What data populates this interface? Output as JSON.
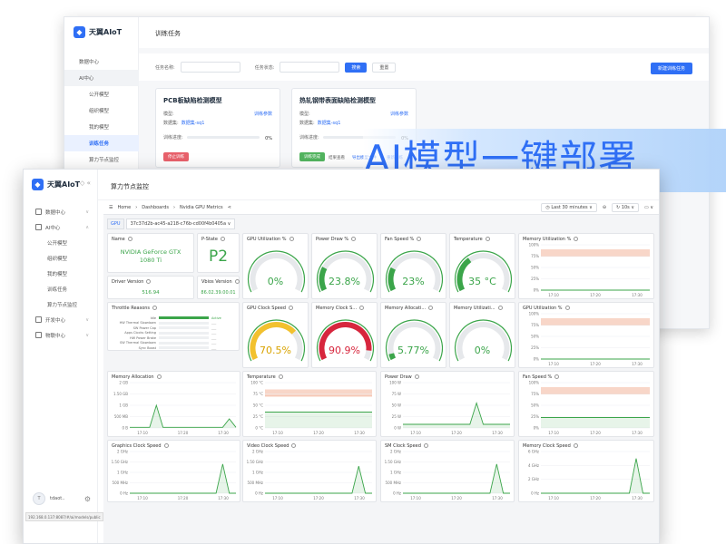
{
  "colors": {
    "accent": "#2f6ff5",
    "green": "#3ba54a",
    "yellow": "#f2c12e",
    "red": "#d7263d",
    "orange_band": "#f2b8a2"
  },
  "back_window": {
    "brand": "天翼AIoT",
    "menu": [
      {
        "label": "数据中心",
        "type": "item"
      },
      {
        "label": "AI中心",
        "type": "group"
      },
      {
        "label": "公开模型",
        "type": "sub"
      },
      {
        "label": "组织模型",
        "type": "sub"
      },
      {
        "label": "我的模型",
        "type": "sub"
      },
      {
        "label": "训练任务",
        "type": "active"
      },
      {
        "label": "算力节点监控",
        "type": "sub"
      },
      {
        "label": "开发中心",
        "type": "item"
      }
    ],
    "page_title": "训练任务",
    "filter": {
      "task_name_label": "任务名称:",
      "task_status_label": "任务状态:",
      "search": "搜索",
      "reset": "重置",
      "new_task": "新建训练任务"
    },
    "cards": [
      {
        "title": "PCB板缺陷检测模型",
        "model_label": "模型:",
        "model_link": "训练参数",
        "dataset_label": "数据集:",
        "dataset_value": "数据集-sq1",
        "progress_label": "训练进度:",
        "progress": "0%",
        "tag": "停止训练",
        "tag_color": "#e8616b"
      },
      {
        "title": "热轧钢带表面缺陷检测模型",
        "model_label": "模型:",
        "model_link": "训练参数",
        "dataset_label": "数据集:",
        "dataset_value": "数据集-sq1",
        "progress_label": "训练进度:",
        "progress": "0%",
        "tag": "训练完成",
        "tag_color": "#52b45f",
        "extra1": "结果查看",
        "extra2": "导出模型文件",
        "extra3": "重新训练"
      }
    ]
  },
  "banner": {
    "text": "AI模型一键部署"
  },
  "front_window": {
    "brand": "天翼AIoT",
    "menu": [
      {
        "label": "数据中心",
        "type": "item",
        "chev": "∨"
      },
      {
        "label": "AI中心",
        "type": "item",
        "chev": "∧"
      },
      {
        "label": "公开模型",
        "type": "sub"
      },
      {
        "label": "组织模型",
        "type": "sub"
      },
      {
        "label": "我的模型",
        "type": "sub"
      },
      {
        "label": "训练任务",
        "type": "sub"
      },
      {
        "label": "算力节点监控",
        "type": "sub"
      },
      {
        "label": "开发中心",
        "type": "item",
        "chev": "∨"
      },
      {
        "label": "物联中心",
        "type": "item",
        "chev": "∨"
      }
    ],
    "page_title": "算力节点监控",
    "user": {
      "avatar": "T",
      "name": "tdaot.."
    },
    "status_url": "192.168.0.137:8087/#/ai/models/public"
  },
  "grafana": {
    "breadcrumb": [
      "Home",
      "Dashboards",
      "Nvidia GPU Metrics"
    ],
    "time_range": "Last 30 minutes",
    "refresh": "10s",
    "var_label": "GPU",
    "var_value": "37c37d2b-ac45-a218-c76b-cd00f4b0405a"
  },
  "panels": {
    "name": {
      "title": "Name",
      "value": "NVIDIA GeForce GTX 1080 Ti"
    },
    "pstate": {
      "title": "P-State",
      "value": "P2"
    },
    "driver": {
      "title": "Driver Version",
      "value": "516.94"
    },
    "vbios": {
      "title": "Vbios Version",
      "value": "86.02.39.00.01"
    },
    "throttle": {
      "title": "Throttle Reasons",
      "rows": [
        "Idle",
        "HW Thermal Slowdown",
        "SW Power Cap",
        "Apps Clocks Setting",
        "HW Power Brake",
        "SW Thermal Slowdown",
        "Sync Boost"
      ],
      "active_label": "Active"
    },
    "gauges": [
      {
        "title": "GPU Utilization %",
        "value": 0,
        "display": "0%",
        "color": "#3ba54a"
      },
      {
        "title": "Power Draw %",
        "value": 23.8,
        "display": "23.8%",
        "color": "#3ba54a"
      },
      {
        "title": "Fan Speed %",
        "value": 23,
        "display": "23%",
        "color": "#3ba54a"
      },
      {
        "title": "Temperature",
        "value": 35,
        "display": "35 °C",
        "color": "#3ba54a"
      },
      {
        "title": "GPU Clock Speed",
        "value": 70.5,
        "display": "70.5%",
        "color": "#f2c12e"
      },
      {
        "title": "Memory Clock S...",
        "value": 90.9,
        "display": "90.9%",
        "color": "#d7263d"
      },
      {
        "title": "Memory Allocati...",
        "value": 5.77,
        "display": "5.77%",
        "color": "#3ba54a"
      },
      {
        "title": "Memory Utilizati...",
        "value": 0,
        "display": "0%",
        "color": "#3ba54a"
      }
    ]
  },
  "chart_data": [
    {
      "type": "line",
      "title": "Memory Utilization %",
      "y_ticks": [
        "100%",
        "75%",
        "50%",
        "25%",
        "0%"
      ],
      "x_ticks": [
        "17:10",
        "17:20",
        "17:30"
      ],
      "ylim": [
        0,
        100
      ],
      "threshold_bands": [
        [
          75,
          90
        ]
      ],
      "values": [
        0,
        0,
        0,
        0,
        0,
        0,
        0,
        0
      ]
    },
    {
      "type": "line",
      "title": "GPU Utilization %",
      "y_ticks": [
        "100%",
        "75%",
        "50%",
        "25%",
        "0%"
      ],
      "x_ticks": [
        "17:10",
        "17:20",
        "17:30"
      ],
      "ylim": [
        0,
        100
      ],
      "threshold_bands": [
        [
          75,
          90
        ]
      ],
      "values": [
        0,
        0,
        0,
        0,
        0,
        0,
        0,
        0
      ]
    },
    {
      "type": "line",
      "title": "Memory Allocation",
      "y_ticks": [
        "2 GB",
        "1.50 GB",
        "1 GB",
        "500 MB",
        "0 B"
      ],
      "x_ticks": [
        "17:10",
        "17:20",
        "17:30"
      ],
      "ylim": [
        0,
        2
      ],
      "values": [
        0.03,
        0.03,
        0.03,
        0.03,
        1.0,
        0.03,
        0.03,
        0.03,
        0.03,
        0.03,
        0.03,
        0.03,
        0.03,
        0.03,
        0.03,
        0.4,
        0.03
      ]
    },
    {
      "type": "line",
      "title": "Temperature",
      "y_ticks": [
        "100 °C",
        "75 °C",
        "50 °C",
        "25 °C",
        "0 °C"
      ],
      "x_ticks": [
        "17:10",
        "17:20",
        "17:30"
      ],
      "ylim": [
        0,
        100
      ],
      "threshold_bands": [
        [
          70,
          85
        ]
      ],
      "values": [
        35,
        35,
        35,
        35,
        35,
        35,
        35,
        35,
        35,
        35,
        35,
        35,
        35,
        35,
        35,
        35,
        35
      ]
    },
    {
      "type": "line",
      "title": "Power Draw",
      "y_ticks": [
        "100 W",
        "75 W",
        "50 W",
        "25 W",
        "0 W"
      ],
      "x_ticks": [
        "17:10",
        "17:20",
        "17:30"
      ],
      "ylim": [
        0,
        100
      ],
      "values": [
        8,
        8,
        8,
        8,
        8,
        8,
        8,
        8,
        8,
        8,
        8,
        55,
        8,
        8,
        8,
        8,
        8
      ]
    },
    {
      "type": "line",
      "title": "Fan Speed %",
      "y_ticks": [
        "100%",
        "75%",
        "50%",
        "25%",
        "0%"
      ],
      "x_ticks": [
        "17:10",
        "17:20",
        "17:30"
      ],
      "ylim": [
        0,
        100
      ],
      "threshold_bands": [
        [
          75,
          90
        ]
      ],
      "values": [
        23,
        23,
        23,
        23,
        23,
        23,
        23,
        23,
        23,
        23,
        23,
        23,
        23,
        23,
        23,
        23,
        23
      ]
    },
    {
      "type": "line",
      "title": "Graphics Clock Speed",
      "y_ticks": [
        "2 GHz",
        "1.50 GHz",
        "1 GHz",
        "500 MHz",
        "0 Hz"
      ],
      "x_ticks": [
        "17:10",
        "17:20",
        "17:30"
      ],
      "ylim": [
        0,
        2000
      ],
      "values": [
        0,
        0,
        0,
        0,
        0,
        0,
        0,
        0,
        0,
        0,
        0,
        0,
        0,
        0,
        1400,
        0,
        0
      ]
    },
    {
      "type": "line",
      "title": "Video Clock Speed",
      "y_ticks": [
        "2 GHz",
        "1.50 GHz",
        "1 GHz",
        "500 MHz",
        "0 Hz"
      ],
      "x_ticks": [
        "17:10",
        "17:20",
        "17:30"
      ],
      "ylim": [
        0,
        2000
      ],
      "values": [
        0,
        0,
        0,
        0,
        0,
        0,
        0,
        0,
        0,
        0,
        0,
        0,
        0,
        0,
        1300,
        0,
        0
      ]
    },
    {
      "type": "line",
      "title": "SM Clock Speed",
      "y_ticks": [
        "2 GHz",
        "1.50 GHz",
        "1 GHz",
        "500 MHz",
        "0 Hz"
      ],
      "x_ticks": [
        "17:10",
        "17:20",
        "17:30"
      ],
      "ylim": [
        0,
        2000
      ],
      "values": [
        0,
        0,
        0,
        0,
        0,
        0,
        0,
        0,
        0,
        0,
        0,
        0,
        0,
        0,
        1400,
        0,
        0
      ]
    },
    {
      "type": "line",
      "title": "Memory Clock Speed",
      "y_ticks": [
        "6 GHz",
        "4 GHz",
        "2 GHz",
        "0 Hz"
      ],
      "x_ticks": [
        "17:10",
        "17:20",
        "17:30"
      ],
      "ylim": [
        0,
        6000
      ],
      "values": [
        0,
        0,
        0,
        0,
        0,
        0,
        0,
        0,
        0,
        0,
        0,
        0,
        0,
        0,
        5000,
        0,
        0
      ]
    }
  ]
}
